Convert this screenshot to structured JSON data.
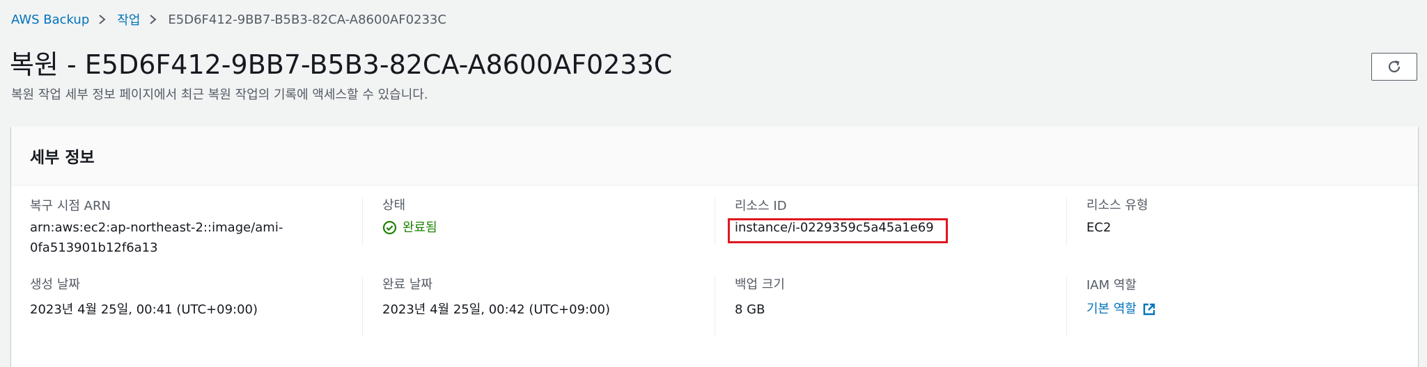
{
  "breadcrumb": {
    "items": [
      "AWS Backup",
      "작업"
    ],
    "current": "E5D6F412-9BB7-B5B3-82CA-A8600AF0233C"
  },
  "header": {
    "title": "복원 - E5D6F412-9BB7-B5B3-82CA-A8600AF0233C",
    "description": "복원 작업 세부 정보 페이지에서 최근 복원 작업의 기록에 액세스할 수 있습니다."
  },
  "details": {
    "title": "세부 정보",
    "recovery_point_arn": {
      "label": "복구 시점 ARN",
      "value_line1": "arn:aws:ec2:ap-northeast-2::image/ami-",
      "value_line2": "0fa513901b12f6a13"
    },
    "status": {
      "label": "상태",
      "value": "완료됨"
    },
    "resource_id": {
      "label": "리소스 ID",
      "value": "instance/i-0229359c5a45a1e69"
    },
    "resource_type": {
      "label": "리소스 유형",
      "value": "EC2"
    },
    "creation_date": {
      "label": "생성 날짜",
      "value": "2023년 4월 25일, 00:41 (UTC+09:00)"
    },
    "completion_date": {
      "label": "완료 날짜",
      "value": "2023년 4월 25일, 00:42 (UTC+09:00)"
    },
    "backup_size": {
      "label": "백업 크기",
      "value": "8 GB"
    },
    "iam_role": {
      "label": "IAM 역할",
      "value": "기본 역할"
    }
  },
  "icons": {
    "breadcrumb_separator": "chevron-right-icon",
    "refresh": "refresh-icon",
    "status": "check-circle-icon",
    "external_link": "external-link-icon"
  },
  "colors": {
    "link": "#0073bb",
    "success": "#1d8102",
    "highlight": "#e0161f"
  }
}
